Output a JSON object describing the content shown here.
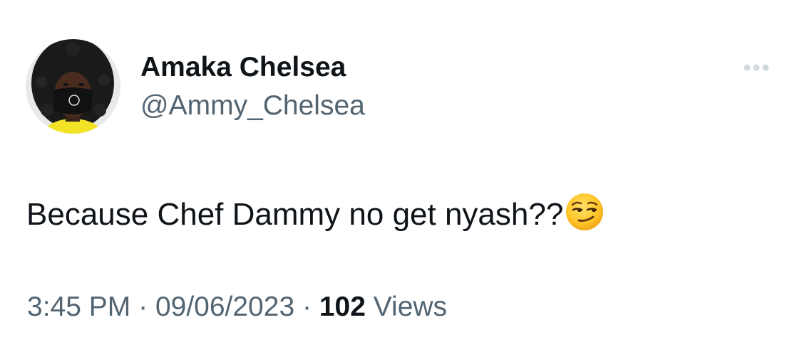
{
  "author": {
    "display_name": "Amaka Chelsea",
    "handle": "@Ammy_Chelsea",
    "avatar_icon": "profile-photo"
  },
  "more_icon": "more-horizontal-icon",
  "tweet": {
    "text": "Because Chef Dammy no get nyash??",
    "emoji": "smirking-face"
  },
  "meta": {
    "time": "3:45 PM",
    "separator": "·",
    "date": "09/06/2023",
    "views_count": "102",
    "views_label": "Views"
  },
  "colors": {
    "primary_text": "#0f1419",
    "secondary_text": "#536471",
    "background": "#ffffff"
  }
}
